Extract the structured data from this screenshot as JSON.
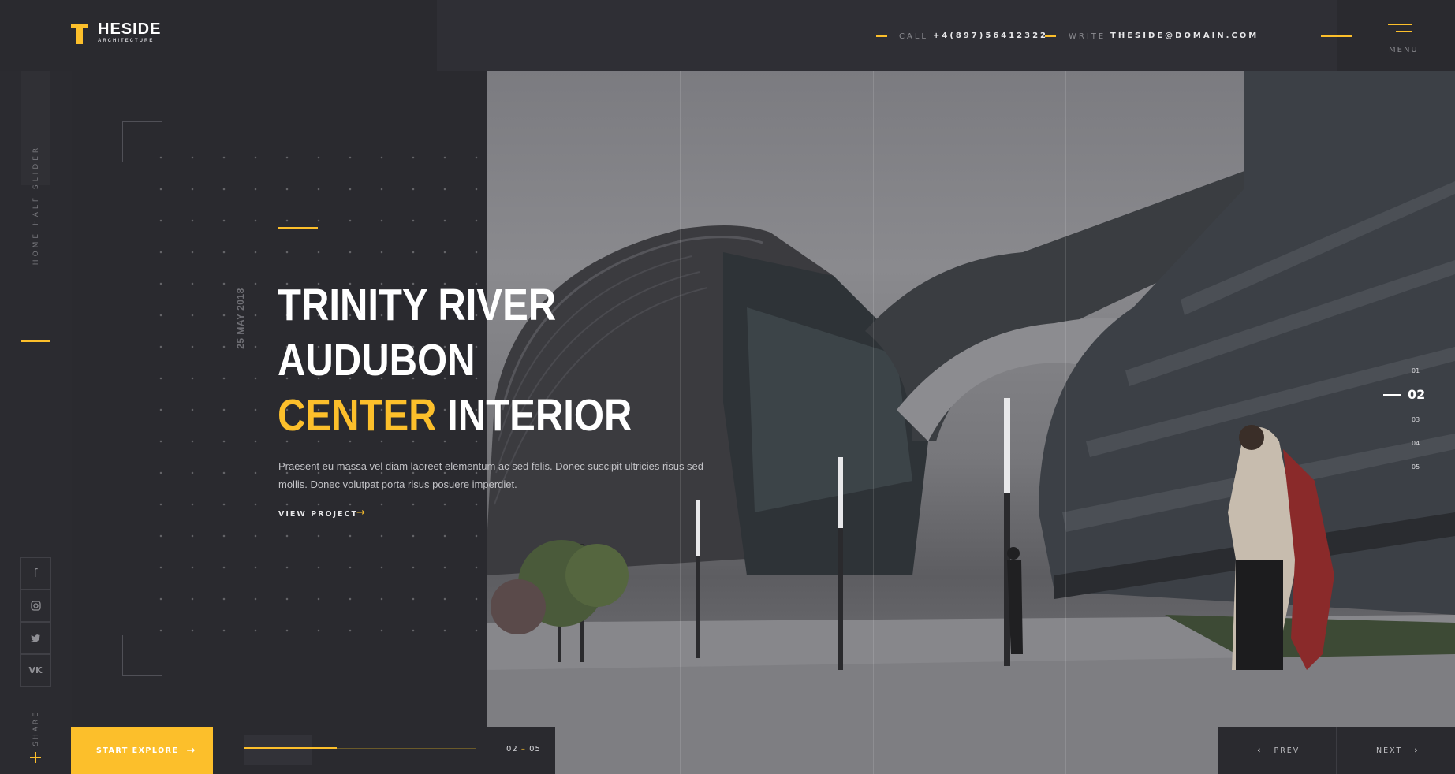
{
  "brand": {
    "name": "HESIDE",
    "subtitle": "ARCHITECTURE",
    "accent_color": "#fcbf2b"
  },
  "header": {
    "call_label": "CALL",
    "call_value": "+4(897)56412322",
    "write_label": "WRITE",
    "write_value": "THESIDE@DOMAIN.COM",
    "menu_label": "MENU"
  },
  "sidebar": {
    "vertical_text": "HOME HALF SLIDER",
    "share_label": "SHARE",
    "social_icons": [
      "facebook-icon",
      "instagram-icon",
      "twitter-icon",
      "vk-icon"
    ]
  },
  "hero": {
    "date": "25 MAY 2018",
    "title_line1": "TRINITY RIVER",
    "title_line2": "AUDUBON",
    "title_line3_accent": "CENTER",
    "title_line3_rest": "INTERIOR",
    "description": "Praesent eu massa vel diam laoreet elementum ac sed felis. Donec suscipit ultricies risus sed mollis. Donec volutpat porta risus posuere imperdiet.",
    "view_link": "VIEW PROJECT"
  },
  "slider": {
    "slides": [
      "01",
      "02",
      "03",
      "04",
      "05"
    ],
    "active": "02",
    "current_page": "02",
    "total_pages": "05",
    "progress": 0.4
  },
  "footer": {
    "explore_button": "START EXPLORE",
    "prev_label": "PREV",
    "next_label": "NEXT"
  }
}
